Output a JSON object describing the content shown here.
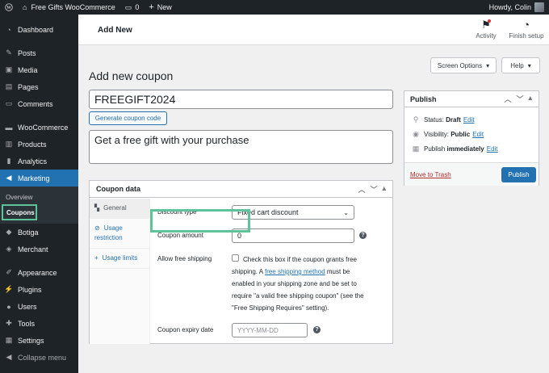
{
  "adminbar": {
    "site_name": "Free Gifts WooCommerce",
    "comments_count": "0",
    "new_label": "New",
    "greeting": "Howdy, Colin"
  },
  "sidebar": {
    "items": [
      {
        "label": "Dashboard",
        "icon": "dashboard-icon"
      },
      {
        "label": "Posts",
        "icon": "pin-icon"
      },
      {
        "label": "Media",
        "icon": "media-icon"
      },
      {
        "label": "Pages",
        "icon": "pages-icon"
      },
      {
        "label": "Comments",
        "icon": "comment-icon"
      },
      {
        "label": "WooCommerce",
        "icon": "woo-icon"
      },
      {
        "label": "Products",
        "icon": "products-icon"
      },
      {
        "label": "Analytics",
        "icon": "analytics-icon"
      },
      {
        "label": "Marketing",
        "icon": "megaphone-icon"
      }
    ],
    "marketing_sub": {
      "overview": "Overview",
      "coupons": "Coupons"
    },
    "items2": [
      {
        "label": "Botiga",
        "icon": "botiga-icon"
      },
      {
        "label": "Merchant",
        "icon": "merchant-icon"
      },
      {
        "label": "Appearance",
        "icon": "brush-icon"
      },
      {
        "label": "Plugins",
        "icon": "plugin-icon"
      },
      {
        "label": "Users",
        "icon": "user-icon"
      },
      {
        "label": "Tools",
        "icon": "wrench-icon"
      },
      {
        "label": "Settings",
        "icon": "settings-icon"
      },
      {
        "label": "Collapse menu",
        "icon": "collapse-icon"
      }
    ]
  },
  "topbar": {
    "title": "Add New",
    "activity": "Activity",
    "finish_setup": "Finish setup"
  },
  "screen_options": "Screen Options",
  "help": "Help",
  "page_heading": "Add new coupon",
  "coupon": {
    "code": "FREEGIFT2024",
    "generate_label": "Generate coupon code",
    "description": "Get a free gift with your purchase"
  },
  "coupon_data": {
    "title": "Coupon data",
    "tabs": {
      "general": "General",
      "usage_restriction": "Usage restriction",
      "usage_limits": "Usage limits"
    },
    "discount_type_label": "Discount type",
    "discount_type_value": "Fixed cart discount",
    "amount_label": "Coupon amount",
    "amount_value": "0",
    "free_shipping_label": "Allow free shipping",
    "free_shipping_text_1": "Check this box if the coupon grants free shipping. A",
    "free_shipping_link": "free shipping method",
    "free_shipping_text_2": "must be enabled in your shipping zone and be set to require \"a valid free shipping coupon\" (see the \"Free Shipping Requires\" setting).",
    "expiry_label": "Coupon expiry date",
    "expiry_placeholder": "YYYY-MM-DD"
  },
  "publish": {
    "title": "Publish",
    "status_label": "Status:",
    "status_value": "Draft",
    "visibility_label": "Visibility:",
    "visibility_value": "Public",
    "publish_label": "Publish",
    "publish_value": "immediately",
    "edit": "Edit",
    "trash": "Move to Trash",
    "button": "Publish"
  },
  "colors": {
    "accent": "#2271b1",
    "highlight": "#5ec29a",
    "admin_dark": "#1d2327"
  }
}
